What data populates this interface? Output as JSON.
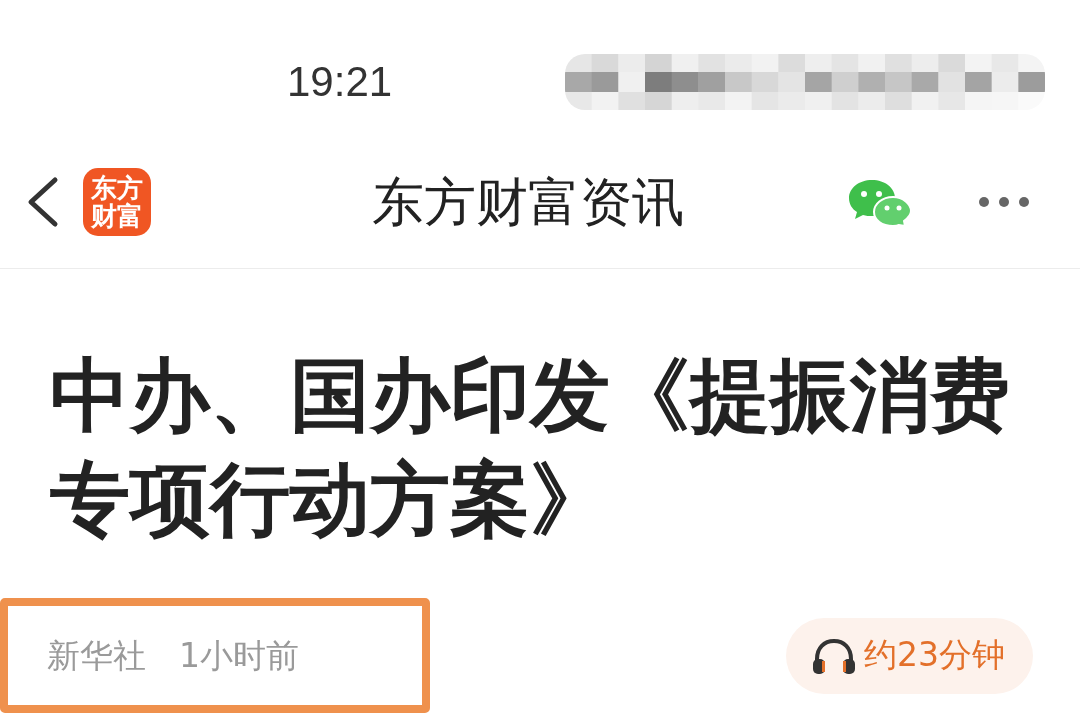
{
  "status_bar": {
    "time": "19:21"
  },
  "nav_bar": {
    "logo": {
      "lines": [
        "东方",
        "财富"
      ]
    },
    "title": "东方财富资讯"
  },
  "article": {
    "headline": "中办、国办印发《提振消费专项行动方案》",
    "meta": {
      "highlighted": true,
      "source": "新华社",
      "time": "1小时前"
    },
    "listen_button": {
      "label": "约23分钟"
    }
  }
}
